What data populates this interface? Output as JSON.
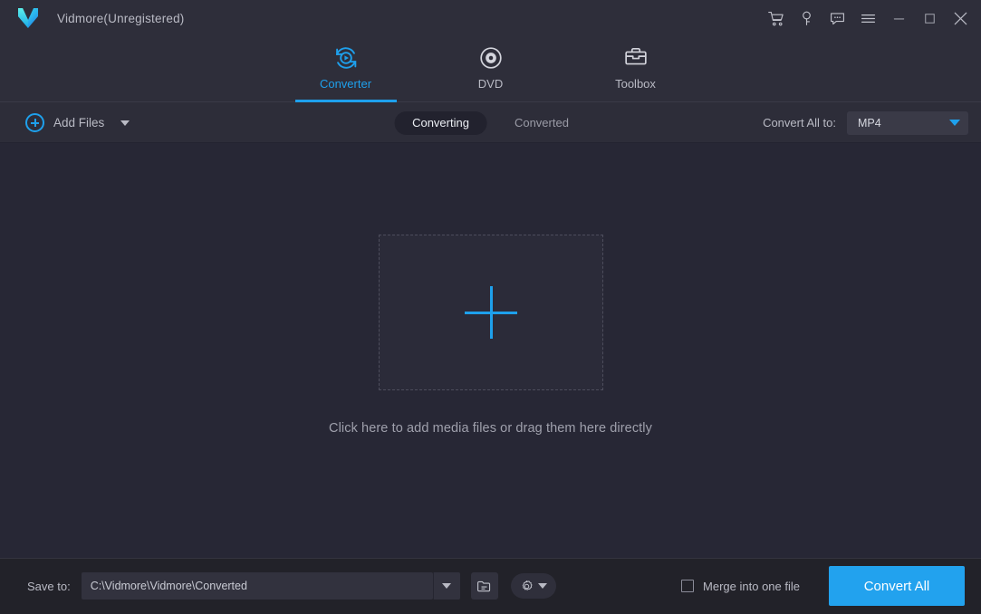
{
  "window": {
    "title": "Vidmore(Unregistered)",
    "logo_icon": "vidmore-v-logo",
    "controls": [
      {
        "name": "cart-icon",
        "label": "Cart"
      },
      {
        "name": "key-icon",
        "label": "Register"
      },
      {
        "name": "chat-icon",
        "label": "Feedback"
      },
      {
        "name": "hamburger-menu-icon",
        "label": "Menu"
      },
      {
        "name": "minimize-icon",
        "label": "Minimize"
      },
      {
        "name": "maximize-icon",
        "label": "Maximize"
      },
      {
        "name": "close-icon",
        "label": "Close"
      }
    ]
  },
  "nav": {
    "tabs": [
      {
        "label": "Converter",
        "icon": "converter-icon",
        "active": true
      },
      {
        "label": "DVD",
        "icon": "dvd-disc-icon",
        "active": false
      },
      {
        "label": "Toolbox",
        "icon": "toolbox-icon",
        "active": false
      }
    ]
  },
  "toolbar": {
    "add_files_label": "Add Files",
    "add_files_icon": "plus-circle-icon",
    "add_files_caret_icon": "chevron-down-icon",
    "segments": [
      {
        "label": "Converting",
        "active": true
      },
      {
        "label": "Converted",
        "active": false
      }
    ],
    "convert_all_to_label": "Convert All to:",
    "format_value": "MP4",
    "format_caret_icon": "chevron-down-icon"
  },
  "main": {
    "dropzone_icon": "plus-icon",
    "hint": "Click here to add media files or drag them here directly"
  },
  "bottom": {
    "save_to_label": "Save to:",
    "save_path": "C:\\Vidmore\\Vidmore\\Converted",
    "path_caret_icon": "chevron-down-icon",
    "browse_icon": "folder-icon",
    "settings_icon": "gear-icon",
    "settings_caret_icon": "chevron-down-icon",
    "merge_label": "Merge into one file",
    "merge_checked": false,
    "convert_all_label": "Convert All"
  },
  "colors": {
    "accent": "#1ea0ec",
    "button_blue": "#22a2ee",
    "titlebar_bg": "#2e2e3a",
    "toolbar_bg": "#2d2d39",
    "main_bg": "#272735",
    "bottombar_bg": "#222229",
    "text_primary": "#d6d8e0",
    "text_muted": "#9fa0ac"
  }
}
